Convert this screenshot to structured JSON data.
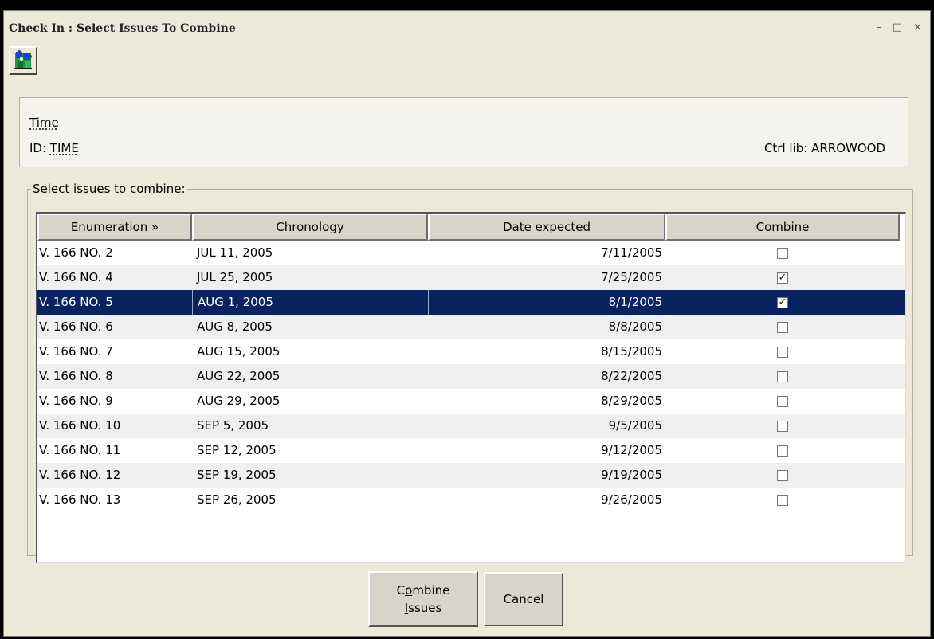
{
  "window": {
    "title": "Check In : Select Issues To Combine",
    "controls": {
      "minimize": "–",
      "maximize": "□",
      "close": "×"
    }
  },
  "toolbar": {
    "icon": "puzzle-icon"
  },
  "header": {
    "title": "Time",
    "id_label": "ID: ",
    "id_value": "TIME",
    "ctrl_lib": "Ctrl lib: ARROWOOD"
  },
  "issues": {
    "legend": "Select issues to combine:",
    "columns": [
      "Enumeration »",
      "Chronology",
      "Date expected",
      "Combine"
    ],
    "rows": [
      {
        "enumeration": "V. 166 NO. 2",
        "chronology": "JUL 11, 2005",
        "date_expected": "7/11/2005",
        "combine": false
      },
      {
        "enumeration": "V. 166 NO. 4",
        "chronology": "JUL 25, 2005",
        "date_expected": "7/25/2005",
        "combine": true
      },
      {
        "enumeration": "V. 166 NO. 5",
        "chronology": "AUG 1, 2005",
        "date_expected": "8/1/2005",
        "combine": true
      },
      {
        "enumeration": "V. 166 NO. 6",
        "chronology": "AUG 8, 2005",
        "date_expected": "8/8/2005",
        "combine": false
      },
      {
        "enumeration": "V. 166 NO. 7",
        "chronology": "AUG 15, 2005",
        "date_expected": "8/15/2005",
        "combine": false
      },
      {
        "enumeration": "V. 166 NO. 8",
        "chronology": "AUG 22, 2005",
        "date_expected": "8/22/2005",
        "combine": false
      },
      {
        "enumeration": "V. 166 NO. 9",
        "chronology": "AUG 29, 2005",
        "date_expected": "8/29/2005",
        "combine": false
      },
      {
        "enumeration": "V. 166 NO. 10",
        "chronology": "SEP 5, 2005",
        "date_expected": "9/5/2005",
        "combine": false
      },
      {
        "enumeration": "V. 166 NO. 11",
        "chronology": "SEP 12, 2005",
        "date_expected": "9/12/2005",
        "combine": false
      },
      {
        "enumeration": "V. 166 NO. 12",
        "chronology": "SEP 19, 2005",
        "date_expected": "9/19/2005",
        "combine": false
      },
      {
        "enumeration": "V. 166 NO. 13",
        "chronology": "SEP 26, 2005",
        "date_expected": "9/26/2005",
        "combine": false
      }
    ],
    "selected_row_index": 2
  },
  "buttons": {
    "combine_line1_pre": "C",
    "combine_line1_u": "o",
    "combine_line1_post": "mbine",
    "combine_line2_u": "I",
    "combine_line2_post": "ssues",
    "cancel": "Cancel"
  },
  "colors": {
    "selection": "#0a2260",
    "window_bg": "#ece9d8",
    "alt_row": "#efefef"
  }
}
